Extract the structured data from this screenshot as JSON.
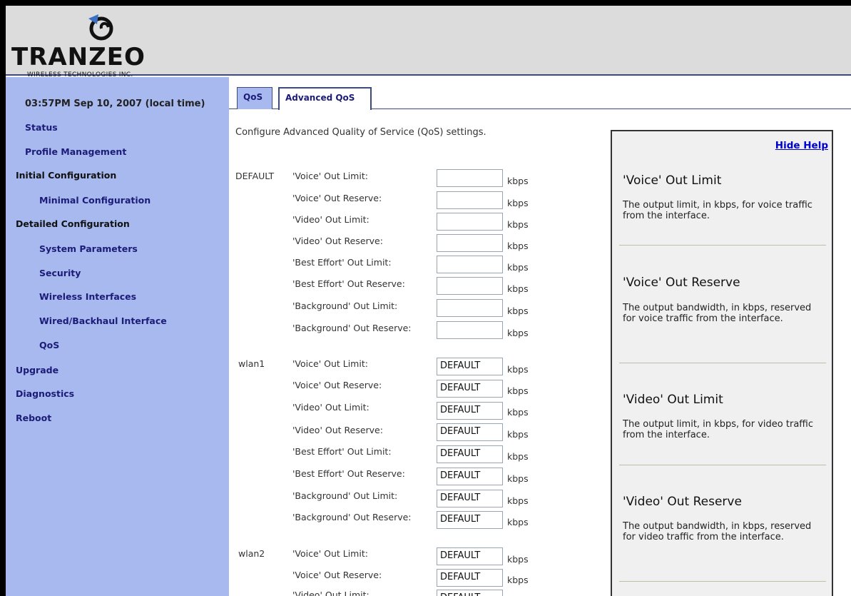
{
  "header": {
    "logo_text": "TRANZEO",
    "logo_subtext": "WIRELESS TECHNOLOGIES INC.",
    "logo_icon": "tranzeo-swirl-logo"
  },
  "sidebar": {
    "clock": "03:57PM Sep 10, 2007 (local time)",
    "items": [
      {
        "label": "Status"
      },
      {
        "label": "Profile Management"
      },
      {
        "label": "Initial Configuration"
      },
      {
        "label": "Minimal Configuration"
      },
      {
        "label": "Detailed Configuration"
      },
      {
        "label": "System Parameters"
      },
      {
        "label": "Security"
      },
      {
        "label": "Wireless Interfaces"
      },
      {
        "label": "Wired/Backhaul Interface"
      },
      {
        "label": "QoS"
      },
      {
        "label": "Upgrade"
      },
      {
        "label": "Diagnostics"
      },
      {
        "label": "Reboot"
      }
    ]
  },
  "tabs": [
    {
      "label": "QoS"
    },
    {
      "label": "Advanced QoS",
      "active": true
    }
  ],
  "main": {
    "intro": "Configure Advanced Quality of Service (QoS) settings.",
    "unit": "kbps",
    "groups": [
      {
        "name": "DEFAULT",
        "rows": [
          {
            "label": "'Voice' Out Limit:",
            "value": ""
          },
          {
            "label": "'Voice' Out Reserve:",
            "value": ""
          },
          {
            "label": "'Video' Out Limit:",
            "value": ""
          },
          {
            "label": "'Video' Out Reserve:",
            "value": ""
          },
          {
            "label": "'Best Effort' Out Limit:",
            "value": ""
          },
          {
            "label": "'Best Effort' Out Reserve:",
            "value": ""
          },
          {
            "label": "'Background' Out Limit:",
            "value": ""
          },
          {
            "label": "'Background' Out Reserve:",
            "value": ""
          }
        ]
      },
      {
        "name": "wlan1",
        "rows": [
          {
            "label": "'Voice' Out Limit:",
            "value": "DEFAULT"
          },
          {
            "label": "'Voice' Out Reserve:",
            "value": "DEFAULT"
          },
          {
            "label": "'Video' Out Limit:",
            "value": "DEFAULT"
          },
          {
            "label": "'Video' Out Reserve:",
            "value": "DEFAULT"
          },
          {
            "label": "'Best Effort' Out Limit:",
            "value": "DEFAULT"
          },
          {
            "label": "'Best Effort' Out Reserve:",
            "value": "DEFAULT"
          },
          {
            "label": "'Background' Out Limit:",
            "value": "DEFAULT"
          },
          {
            "label": "'Background' Out Reserve:",
            "value": "DEFAULT"
          }
        ]
      },
      {
        "name": "wlan2",
        "rows": [
          {
            "label": "'Voice' Out Limit:",
            "value": "DEFAULT"
          },
          {
            "label": "'Voice' Out Reserve:",
            "value": "DEFAULT"
          },
          {
            "label": "'Video' Out Limit:",
            "value": "DEFAULT"
          }
        ]
      }
    ]
  },
  "help": {
    "hide_label": "Hide Help",
    "entries": [
      {
        "title": "'Voice' Out Limit",
        "body": "The output limit, in kbps, for voice traffic from the interface."
      },
      {
        "title": "'Voice' Out Reserve",
        "body": "The output bandwidth, in kbps, reserved for voice traffic from the interface."
      },
      {
        "title": "'Video' Out Limit",
        "body": "The output limit, in kbps, for video traffic from the interface."
      },
      {
        "title": "'Video' Out Reserve",
        "body": "The output bandwidth, in kbps, reserved for video traffic from the interface."
      }
    ]
  },
  "colors": {
    "sidebar_bg": "#a7b9ef",
    "nav_link": "#1c1c78",
    "header_bg": "#dcdcdc",
    "help_link": "#0000cc"
  }
}
